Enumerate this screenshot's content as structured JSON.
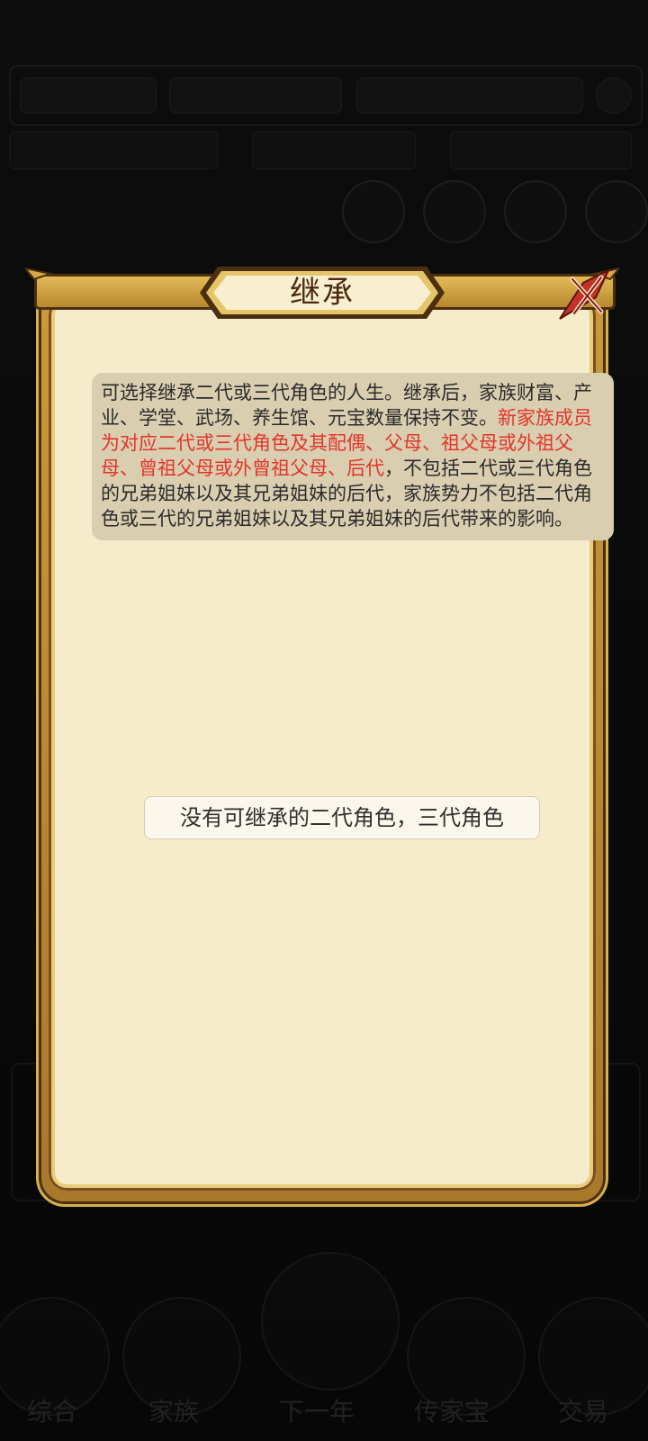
{
  "dialog": {
    "title": "继承",
    "description_part1": "可选择继承二代或三代角色的人生。继承后，家族财富、产业、学堂、武场、养生馆、元宝数量保持不变。",
    "description_highlight": "新家族成员为对应二代或三代角色及其配偶、父母、祖父母或外祖父母、曾祖父母或外曾祖父母、后代",
    "description_part2": "，不包括二代或三代角色的兄弟姐妹以及其兄弟姐妹的后代，家族势力不包括二代角色或三代的兄弟姐妹以及其兄弟姐妹的后代带来的影响。",
    "empty_message": "没有可继承的二代角色，三代角色"
  },
  "background_nav": {
    "items": [
      "综合",
      "家族",
      "下一年",
      "传家宝",
      "交易"
    ]
  },
  "colors": {
    "highlight_text": "#e3352b",
    "panel_bg": "#f6eccb",
    "frame_gold": "#c99a3c"
  },
  "icons": {
    "close": "close-x-icon"
  }
}
